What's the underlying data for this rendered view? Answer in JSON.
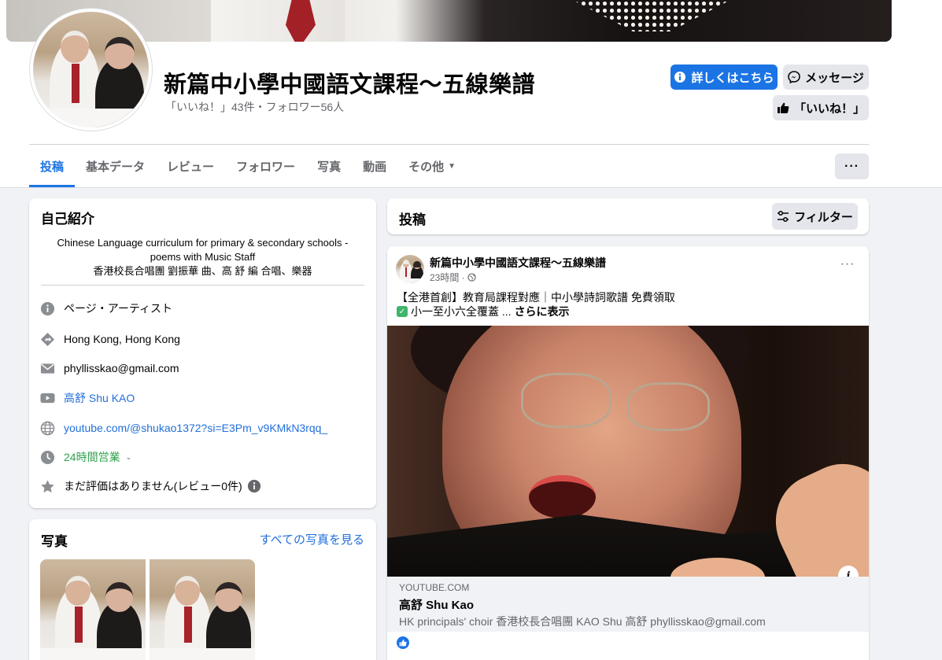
{
  "header": {
    "title": "新篇中小學中國語文課程～五線樂譜",
    "stats": "「いいね！」43件・フォロワー56人"
  },
  "actions": {
    "info_label": "詳しくはこちら",
    "message_label": "メッセージ",
    "like_label": "「いいね！」",
    "more_label": "···"
  },
  "tabs": [
    {
      "label": "投稿",
      "active": true
    },
    {
      "label": "基本データ"
    },
    {
      "label": "レビュー"
    },
    {
      "label": "フォロワー"
    },
    {
      "label": "写真"
    },
    {
      "label": "動画"
    },
    {
      "label": "その他"
    }
  ],
  "intro": {
    "title": "自己紹介",
    "bio_line1": "Chinese Language curriculum for primary & secondary schools -",
    "bio_line2": "poems with Music Staff",
    "bio_line3": "香港校長合唱團 劉振華 曲、高 舒 編 合唱、樂器",
    "category": "ページ・アーティスト",
    "location": "Hong Kong, Hong Kong",
    "email": "phyllisskao@gmail.com",
    "youtube": "高舒 Shu KAO",
    "website": "youtube.com/@shukao1372?si=E3Pm_v9KMkN3rqq_",
    "hours": "24時間営業",
    "rating": "まだ評価はありません(レビュー0件)"
  },
  "photos": {
    "title": "写真",
    "see_all": "すべての写真を見る"
  },
  "posts": {
    "title": "投稿",
    "filter_label": "フィルター"
  },
  "post": {
    "author": "新篇中小學中國語文課程～五線樂譜",
    "time": "23時間 ·",
    "more_label": "···",
    "line1": "【全港首創】教育局課程對應｜中小學詩詞歌譜 免費領取",
    "line2": "小一至小六全覆蓋 ...",
    "see_more": "さらに表示",
    "info_icon": "i",
    "link_domain": "YOUTUBE.COM",
    "link_title": "高舒 Shu Kao",
    "link_desc": "HK principals' choir 香港校長合唱團 KAO Shu 高舒 phyllisskao@gmail.com"
  },
  "colors": {
    "accent": "#1b74e4",
    "link": "#216fdb",
    "open_green": "#31a24c",
    "page_bg": "#f0f2f5"
  },
  "icons": [
    "info-circle-icon",
    "messenger-icon",
    "thumbs-up-icon",
    "caret-down-icon",
    "map-pin-icon",
    "mail-icon",
    "youtube-icon",
    "globe-icon",
    "clock-icon",
    "star-icon",
    "filter-icon",
    "check-icon"
  ]
}
